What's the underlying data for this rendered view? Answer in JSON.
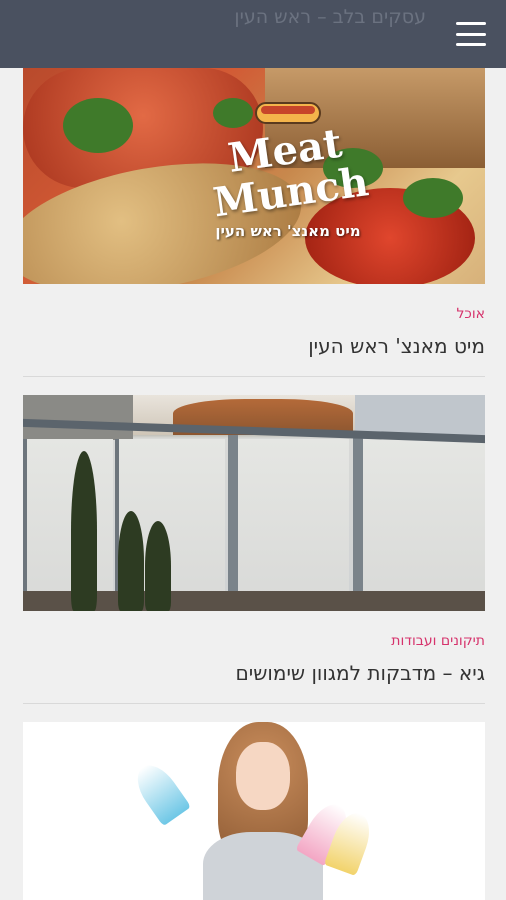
{
  "header": {
    "title_ghost": "עסקים בלב – ראש העין",
    "menu_icon": "hamburger-icon"
  },
  "posts": [
    {
      "image_logo_title_line1": "Meat",
      "image_logo_title_line2": "Munch",
      "image_logo_subtitle": "מיט מאנצ' ראש העין",
      "category": "אוכל",
      "title": "מיט מאנצ' ראש העין"
    },
    {
      "category": "תיקונים ועבודות",
      "title": "גיא – מדבקות למגוון שימושים"
    },
    {
      "category": "",
      "title": ""
    }
  ],
  "colors": {
    "header_bg": "#4a5160",
    "category": "#d6336c",
    "page_bg": "#f0f0f0"
  }
}
